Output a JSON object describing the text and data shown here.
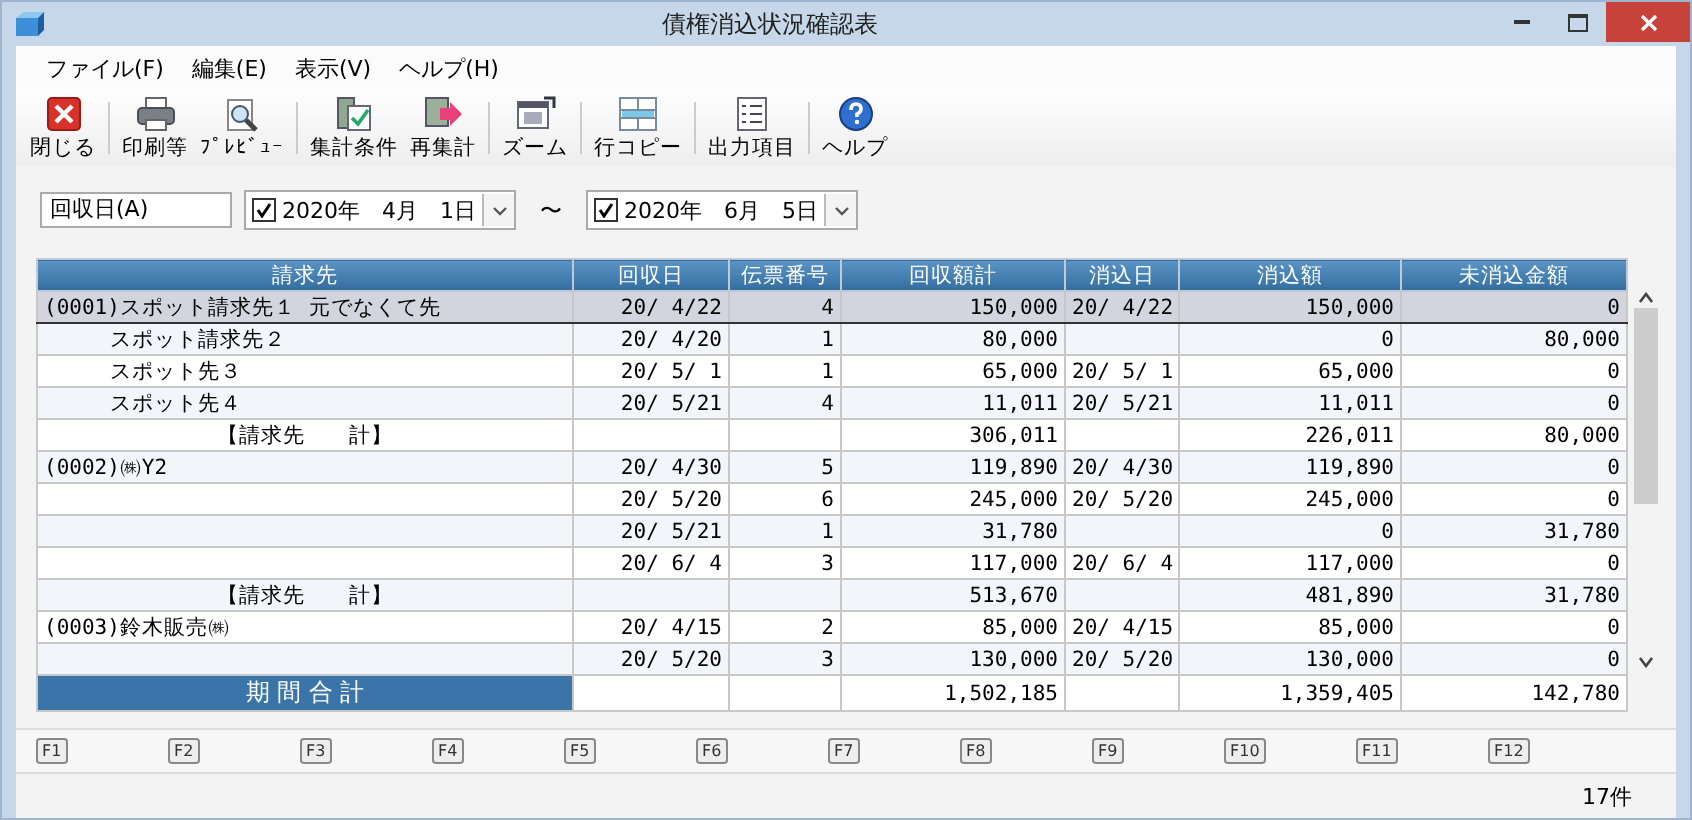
{
  "window": {
    "title": "債権消込状況確認表"
  },
  "menu": [
    "ファイル(F)",
    "編集(E)",
    "表示(V)",
    "ヘルプ(H)"
  ],
  "toolbar": [
    {
      "kind": "close",
      "label": "閉じる"
    },
    {
      "kind": "print",
      "label": "印刷等"
    },
    {
      "kind": "preview",
      "label": "ﾌﾟﾚﾋﾞｭｰ"
    },
    {
      "kind": "conditions",
      "label": "集計条件"
    },
    {
      "kind": "recalc",
      "label": "再集計"
    },
    {
      "kind": "zoom",
      "label": "ズーム"
    },
    {
      "kind": "rowcopy",
      "label": "行コピー"
    },
    {
      "kind": "output",
      "label": "出力項目"
    },
    {
      "kind": "help",
      "label": "ヘルプ"
    }
  ],
  "filter": {
    "field": "回収日(A)",
    "from": {
      "checked": true,
      "value": "2020年　4月　1日"
    },
    "separator": "〜",
    "to": {
      "checked": true,
      "value": "2020年　6月　5日"
    }
  },
  "table": {
    "columns": [
      "請求先",
      "回収日",
      "伝票番号",
      "回収額計",
      "消込日",
      "消込額",
      "未消込金額"
    ],
    "rows": [
      {
        "kind": "client",
        "selected": true,
        "cells": [
          "(0001)スポット請求先１ 元でなくて先",
          "20/ 4/22",
          "4",
          "150,000",
          "20/ 4/22",
          "150,000",
          "0"
        ]
      },
      {
        "kind": "alias",
        "selected": false,
        "cells": [
          "スポット請求先２",
          "20/ 4/20",
          "1",
          "80,000",
          "",
          "0",
          "80,000"
        ]
      },
      {
        "kind": "alias",
        "selected": false,
        "cells": [
          "スポット先３",
          "20/ 5/ 1",
          "1",
          "65,000",
          "20/ 5/ 1",
          "65,000",
          "0"
        ]
      },
      {
        "kind": "alias",
        "selected": false,
        "cells": [
          "スポット先４",
          "20/ 5/21",
          "4",
          "11,011",
          "20/ 5/21",
          "11,011",
          "0"
        ]
      },
      {
        "kind": "subtotal",
        "selected": false,
        "cells": [
          "【請求先　　計】",
          "",
          "",
          "306,011",
          "",
          "226,011",
          "80,000"
        ]
      },
      {
        "kind": "client",
        "selected": false,
        "cells": [
          "(0002)㈱Y2",
          "20/ 4/30",
          "5",
          "119,890",
          "20/ 4/30",
          "119,890",
          "0"
        ]
      },
      {
        "kind": "client",
        "selected": false,
        "cells": [
          "",
          "20/ 5/20",
          "6",
          "245,000",
          "20/ 5/20",
          "245,000",
          "0"
        ]
      },
      {
        "kind": "client",
        "selected": false,
        "cells": [
          "",
          "20/ 5/21",
          "1",
          "31,780",
          "",
          "0",
          "31,780"
        ]
      },
      {
        "kind": "client",
        "selected": false,
        "cells": [
          "",
          "20/ 6/ 4",
          "3",
          "117,000",
          "20/ 6/ 4",
          "117,000",
          "0"
        ]
      },
      {
        "kind": "subtotal",
        "selected": false,
        "cells": [
          "【請求先　　計】",
          "",
          "",
          "513,670",
          "",
          "481,890",
          "31,780"
        ]
      },
      {
        "kind": "client",
        "selected": false,
        "cells": [
          "(0003)鈴木販売㈱",
          "20/ 4/15",
          "2",
          "85,000",
          "20/ 4/15",
          "85,000",
          "0"
        ]
      },
      {
        "kind": "client",
        "selected": false,
        "cells": [
          "",
          "20/ 5/20",
          "3",
          "130,000",
          "20/ 5/20",
          "130,000",
          "0"
        ]
      }
    ],
    "total": {
      "label": "期 間 合 計",
      "cells": [
        "",
        "",
        "1,502,185",
        "",
        "1,359,405",
        "142,780"
      ]
    }
  },
  "function_keys": [
    "F1",
    "F2",
    "F3",
    "F4",
    "F5",
    "F6",
    "F7",
    "F8",
    "F9",
    "F10",
    "F11",
    "F12"
  ],
  "status_bar": {
    "count": "17件"
  }
}
